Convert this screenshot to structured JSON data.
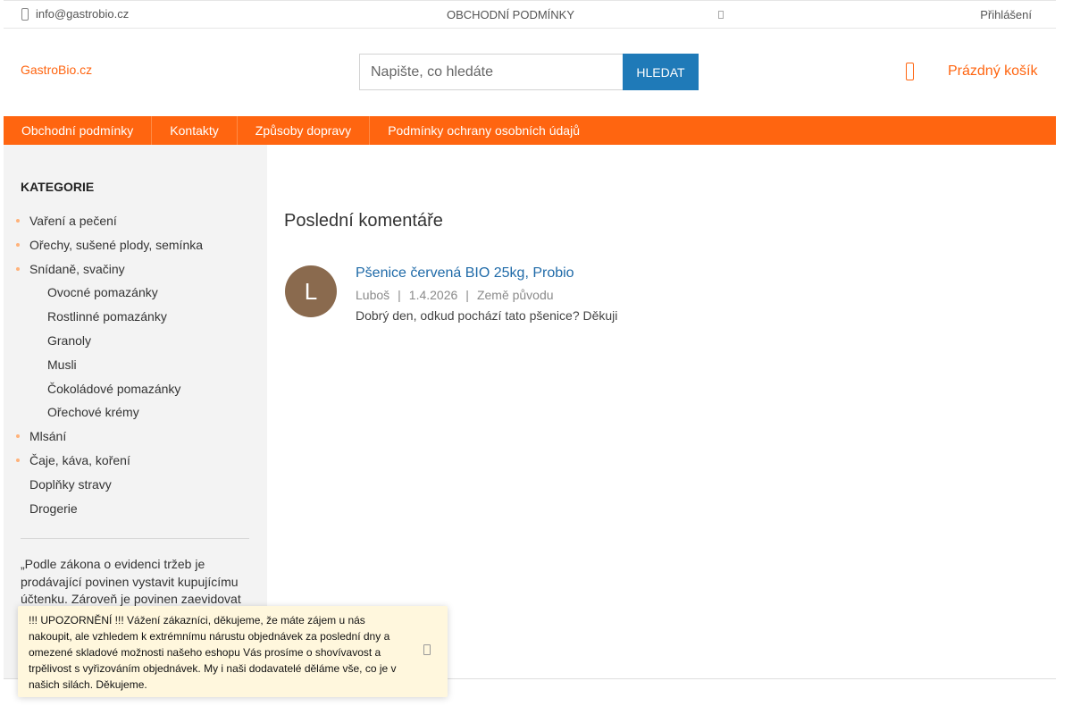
{
  "topbar": {
    "email": "info@gastrobio.cz",
    "terms": "OBCHODNÍ PODMÍNKY",
    "login": "Přihlášení"
  },
  "header": {
    "logo": "GastroBio.cz",
    "search_placeholder": "Napište, co hledáte",
    "search_button": "HLEDAT",
    "cart_label": "Prázdný košík"
  },
  "nav": {
    "items": [
      "Obchodní podmínky",
      "Kontakty",
      "Způsoby dopravy",
      "Podmínky ochrany osobních údajů"
    ]
  },
  "sidebar": {
    "heading": "KATEGORIE",
    "categories": [
      "Vaření a pečení",
      "Ořechy, sušené plody, semínka",
      "Snídaně, svačiny",
      "Ovocné pomazánky",
      "Rostlinné pomazánky",
      "Granoly",
      "Musli",
      "Čokoládové pomazánky",
      "Ořechové krémy",
      "Mlsání",
      "Čaje, káva, koření",
      "Doplňky stravy",
      "Drogerie"
    ],
    "legal": "„Podle zákona o evidenci tržeb je prodávající povinen vystavit kupujícímu účtenku. Zároveň je povinen zaevidovat"
  },
  "main": {
    "title": "Poslední komentáře",
    "comment": {
      "avatar_letter": "L",
      "product": "Pšenice červená BIO 25kg, Probio",
      "author": "Luboš",
      "date": "1.4.2026",
      "topic": "Země původu",
      "separator": "|",
      "text": "Dobrý den, odkud pochází tato pšenice? Děkuji"
    }
  },
  "notice": {
    "text": "!!!   UPOZORNĚNÍ    !!! Vážení zákazníci, děkujeme, že máte zájem u nás nakoupit, ale vzhledem k extrémnímu nárustu objednávek za poslední dny a omezené skladové možnosti našeho eshopu Vás prosíme o shovívavost a trpělivost s vyřizováním objednávek. My i naši dodavatelé děláme vše, co je v našich silách. Děkujeme."
  },
  "colors": {
    "brand": "#ff6510",
    "search_button": "#1f7ab8",
    "link": "#1f6aa8",
    "notice_bg": "#fff7dd"
  }
}
